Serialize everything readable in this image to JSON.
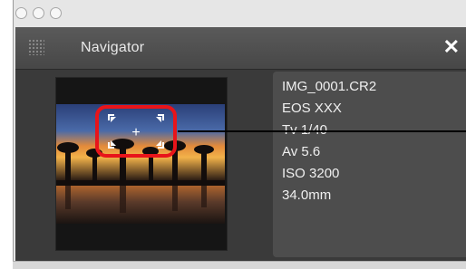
{
  "window": {
    "buttons": [
      "close",
      "minimize",
      "zoom"
    ]
  },
  "panel": {
    "title": "Navigator",
    "close_glyph": "✕"
  },
  "info": {
    "lines": [
      "IMG_0001.CR2",
      "EOS XXX",
      "Tv 1/40",
      "Av 5.6",
      "ISO 3200",
      "34.0mm"
    ]
  },
  "af": {
    "center_glyph": "+"
  },
  "colors": {
    "highlight": "#e8141a",
    "panel_bg": "#383838",
    "title_bar": "#4f4f4f"
  }
}
